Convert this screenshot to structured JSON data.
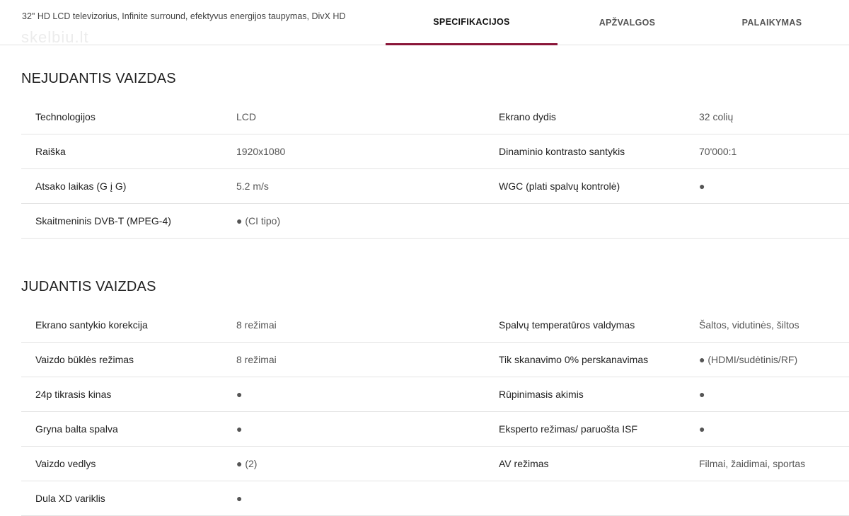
{
  "header": {
    "product_title": "32\" HD LCD televizorius, Infinite surround, efektyvus energijos taupymas, DivX HD",
    "watermark": "skelbiu.lt",
    "tabs": [
      {
        "label": "SPECIFIKACIJOS",
        "active": true
      },
      {
        "label": "APŽVALGOS",
        "active": false
      },
      {
        "label": "PALAIKYMAS",
        "active": false
      }
    ],
    "accent_color": "#8a1538"
  },
  "sections": [
    {
      "title": "NEJUDANTIS VAIZDAS",
      "rows": [
        {
          "left_name": "Technologijos",
          "left_value": "LCD",
          "right_name": "Ekrano dydis",
          "right_value": "32 colių"
        },
        {
          "left_name": "Raiška",
          "left_value": "1920x1080",
          "right_name": "Dinaminio kontrasto santykis",
          "right_value": "70'000:1"
        },
        {
          "left_name": "Atsako laikas (G į G)",
          "left_value": "5.2 m/s",
          "right_name": "WGC (plati spalvų kontrolė)",
          "right_value": "●"
        },
        {
          "left_name": "Skaitmeninis DVB-T (MPEG-4)",
          "left_value": "● (CI tipo)",
          "right_name": "",
          "right_value": ""
        }
      ]
    },
    {
      "title": "JUDANTIS VAIZDAS",
      "rows": [
        {
          "left_name": "Ekrano santykio korekcija",
          "left_value": "8 režimai",
          "right_name": "Spalvų temperatūros valdymas",
          "right_value": "Šaltos, vidutinės, šiltos"
        },
        {
          "left_name": "Vaizdo būklės režimas",
          "left_value": "8 režimai",
          "right_name": "Tik skanavimo 0% perskanavimas",
          "right_value": "● (HDMI/sudėtinis/RF)"
        },
        {
          "left_name": "24p tikrasis kinas",
          "left_value": "●",
          "right_name": "Rūpinimasis akimis",
          "right_value": "●"
        },
        {
          "left_name": "Gryna balta spalva",
          "left_value": "●",
          "right_name": "Eksperto režimas/ paruošta ISF",
          "right_value": "●"
        },
        {
          "left_name": "Vaizdo vedlys",
          "left_value": "● (2)",
          "right_name": "AV režimas",
          "right_value": "Filmai, žaidimai, sportas"
        },
        {
          "left_name": "Dula XD variklis",
          "left_value": "●",
          "right_name": "",
          "right_value": ""
        }
      ]
    }
  ]
}
